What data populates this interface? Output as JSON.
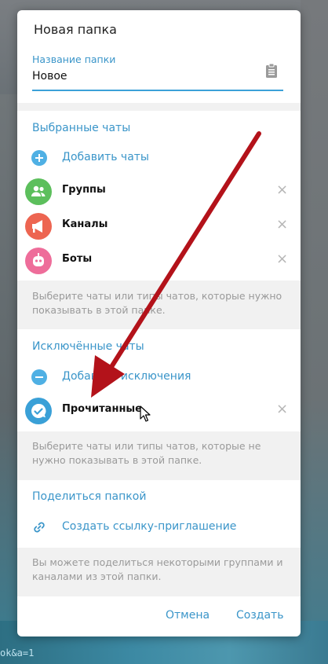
{
  "background": {
    "url_fragment": "ok&a=1"
  },
  "modal": {
    "title": "Новая папка",
    "name_field": {
      "label": "Название папки",
      "value": "Новое"
    },
    "included": {
      "title": "Выбранные чаты",
      "add_label": "Добавить чаты",
      "items": [
        {
          "label": "Группы",
          "icon": "groups-icon",
          "color": "#5cbf5c"
        },
        {
          "label": "Каналы",
          "icon": "megaphone-icon",
          "color": "#ed6551"
        },
        {
          "label": "Боты",
          "icon": "bot-icon",
          "color": "#ee6d9a"
        }
      ],
      "hint": "Выберите чаты или типы чатов, которые нужно показывать в этой папке."
    },
    "excluded": {
      "title": "Исключённые чаты",
      "add_label": "Добавить исключения",
      "items": [
        {
          "label": "Прочитанные",
          "icon": "read-check-icon",
          "color": "#3aa0d7"
        }
      ],
      "hint": "Выберите чаты или типы чатов, которые не нужно показывать в этой папке."
    },
    "share": {
      "title": "Поделиться папкой",
      "link_label": "Создать ссылку-приглашение",
      "hint": "Вы можете поделиться некоторыми группами и каналами из этой папки."
    },
    "buttons": {
      "cancel": "Отмена",
      "create": "Создать"
    }
  },
  "colors": {
    "accent": "#3a95c9",
    "arrow": "#b3121a"
  }
}
